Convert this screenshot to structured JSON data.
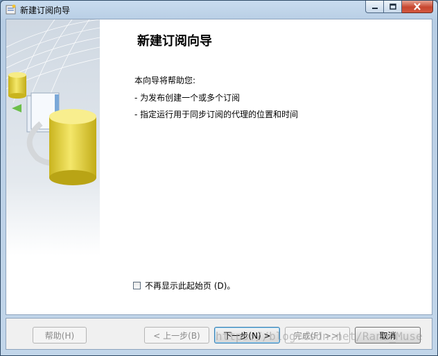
{
  "window": {
    "title": "新建订阅向导"
  },
  "page": {
    "heading": "新建订阅向导",
    "intro": "本向导将帮助您:",
    "bullets": [
      "- 为发布创建一个或多个订阅",
      "- 指定运行用于同步订阅的代理的位置和时间"
    ],
    "checkbox_label": "不再显示此起始页 (D)。",
    "checkbox_checked": false
  },
  "buttons": {
    "help": "帮助(H)",
    "prev": "< 上一步(B)",
    "next": "下一步(N) >",
    "finish": "完成(F) >>|",
    "cancel": "取消"
  },
  "watermark": "https://blog.csdn.net/Rana_Muse",
  "colors": {
    "titlebar": "#b7cde4",
    "close_button": "#c7462f",
    "banner_cylinder": "#e6d23a",
    "default_button_border": "#3c7fb1"
  }
}
